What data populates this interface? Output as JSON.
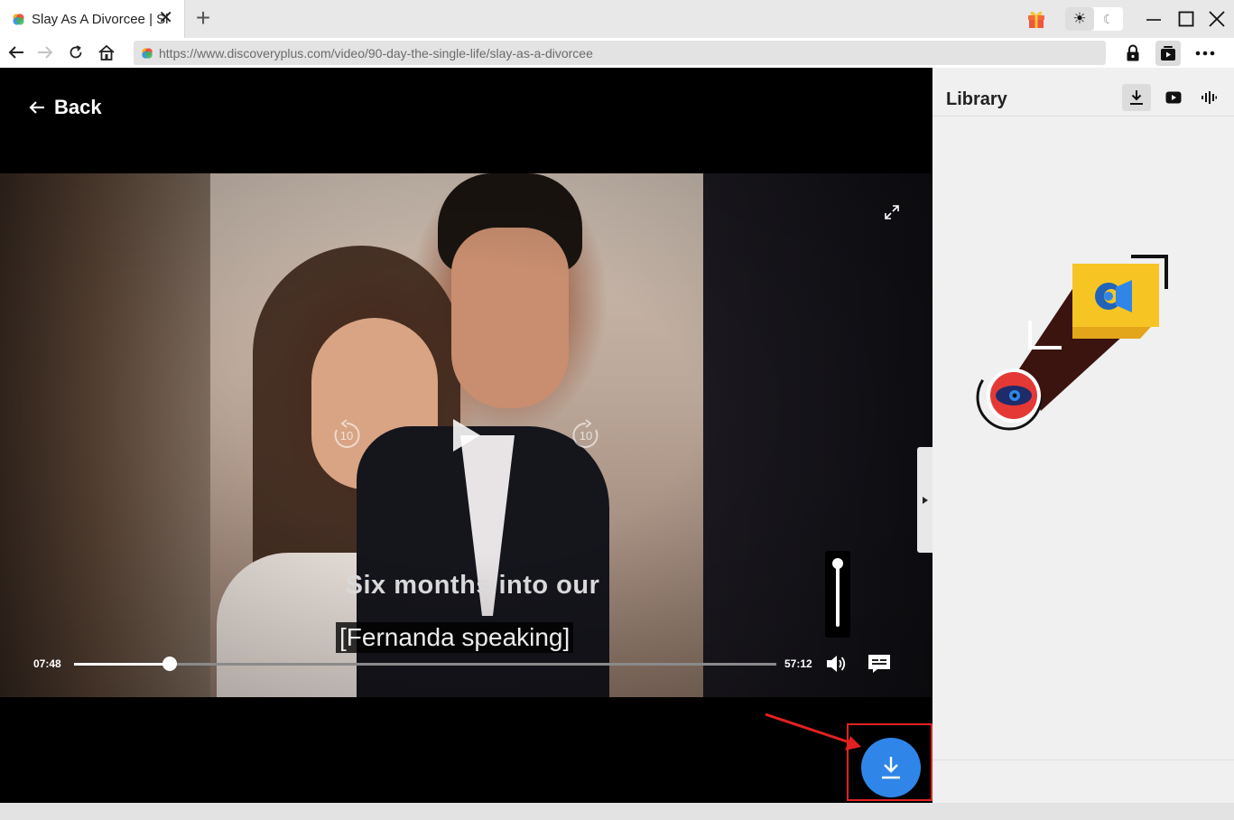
{
  "browser": {
    "tab_title": "Slay As A Divorcee | Sl",
    "url": "https://www.discoveryplus.com/video/90-day-the-single-life/slay-as-a-divorcee"
  },
  "player": {
    "back_label": "Back",
    "subtitle_line1": "Six months into our",
    "subtitle_line2": "[Fernanda speaking]",
    "time_elapsed": "07:48",
    "time_total": "57:12",
    "progress_fraction": 0.136,
    "volume_fraction": 1.0,
    "rewind_label": "10",
    "forward_label": "10",
    "download_color": "#2f86e8",
    "annotation_color": "#e42121"
  },
  "library": {
    "title": "Library",
    "tabs": [
      {
        "icon": "download-icon",
        "active": true
      },
      {
        "icon": "youtube-icon",
        "active": false
      },
      {
        "icon": "audio-wave-icon",
        "active": false
      }
    ]
  },
  "icons": {
    "gift": "gift-icon",
    "sun": "sun-icon",
    "moon": "moon-icon",
    "lock": "lock-icon",
    "media": "media-icon",
    "more": "more-icon"
  }
}
